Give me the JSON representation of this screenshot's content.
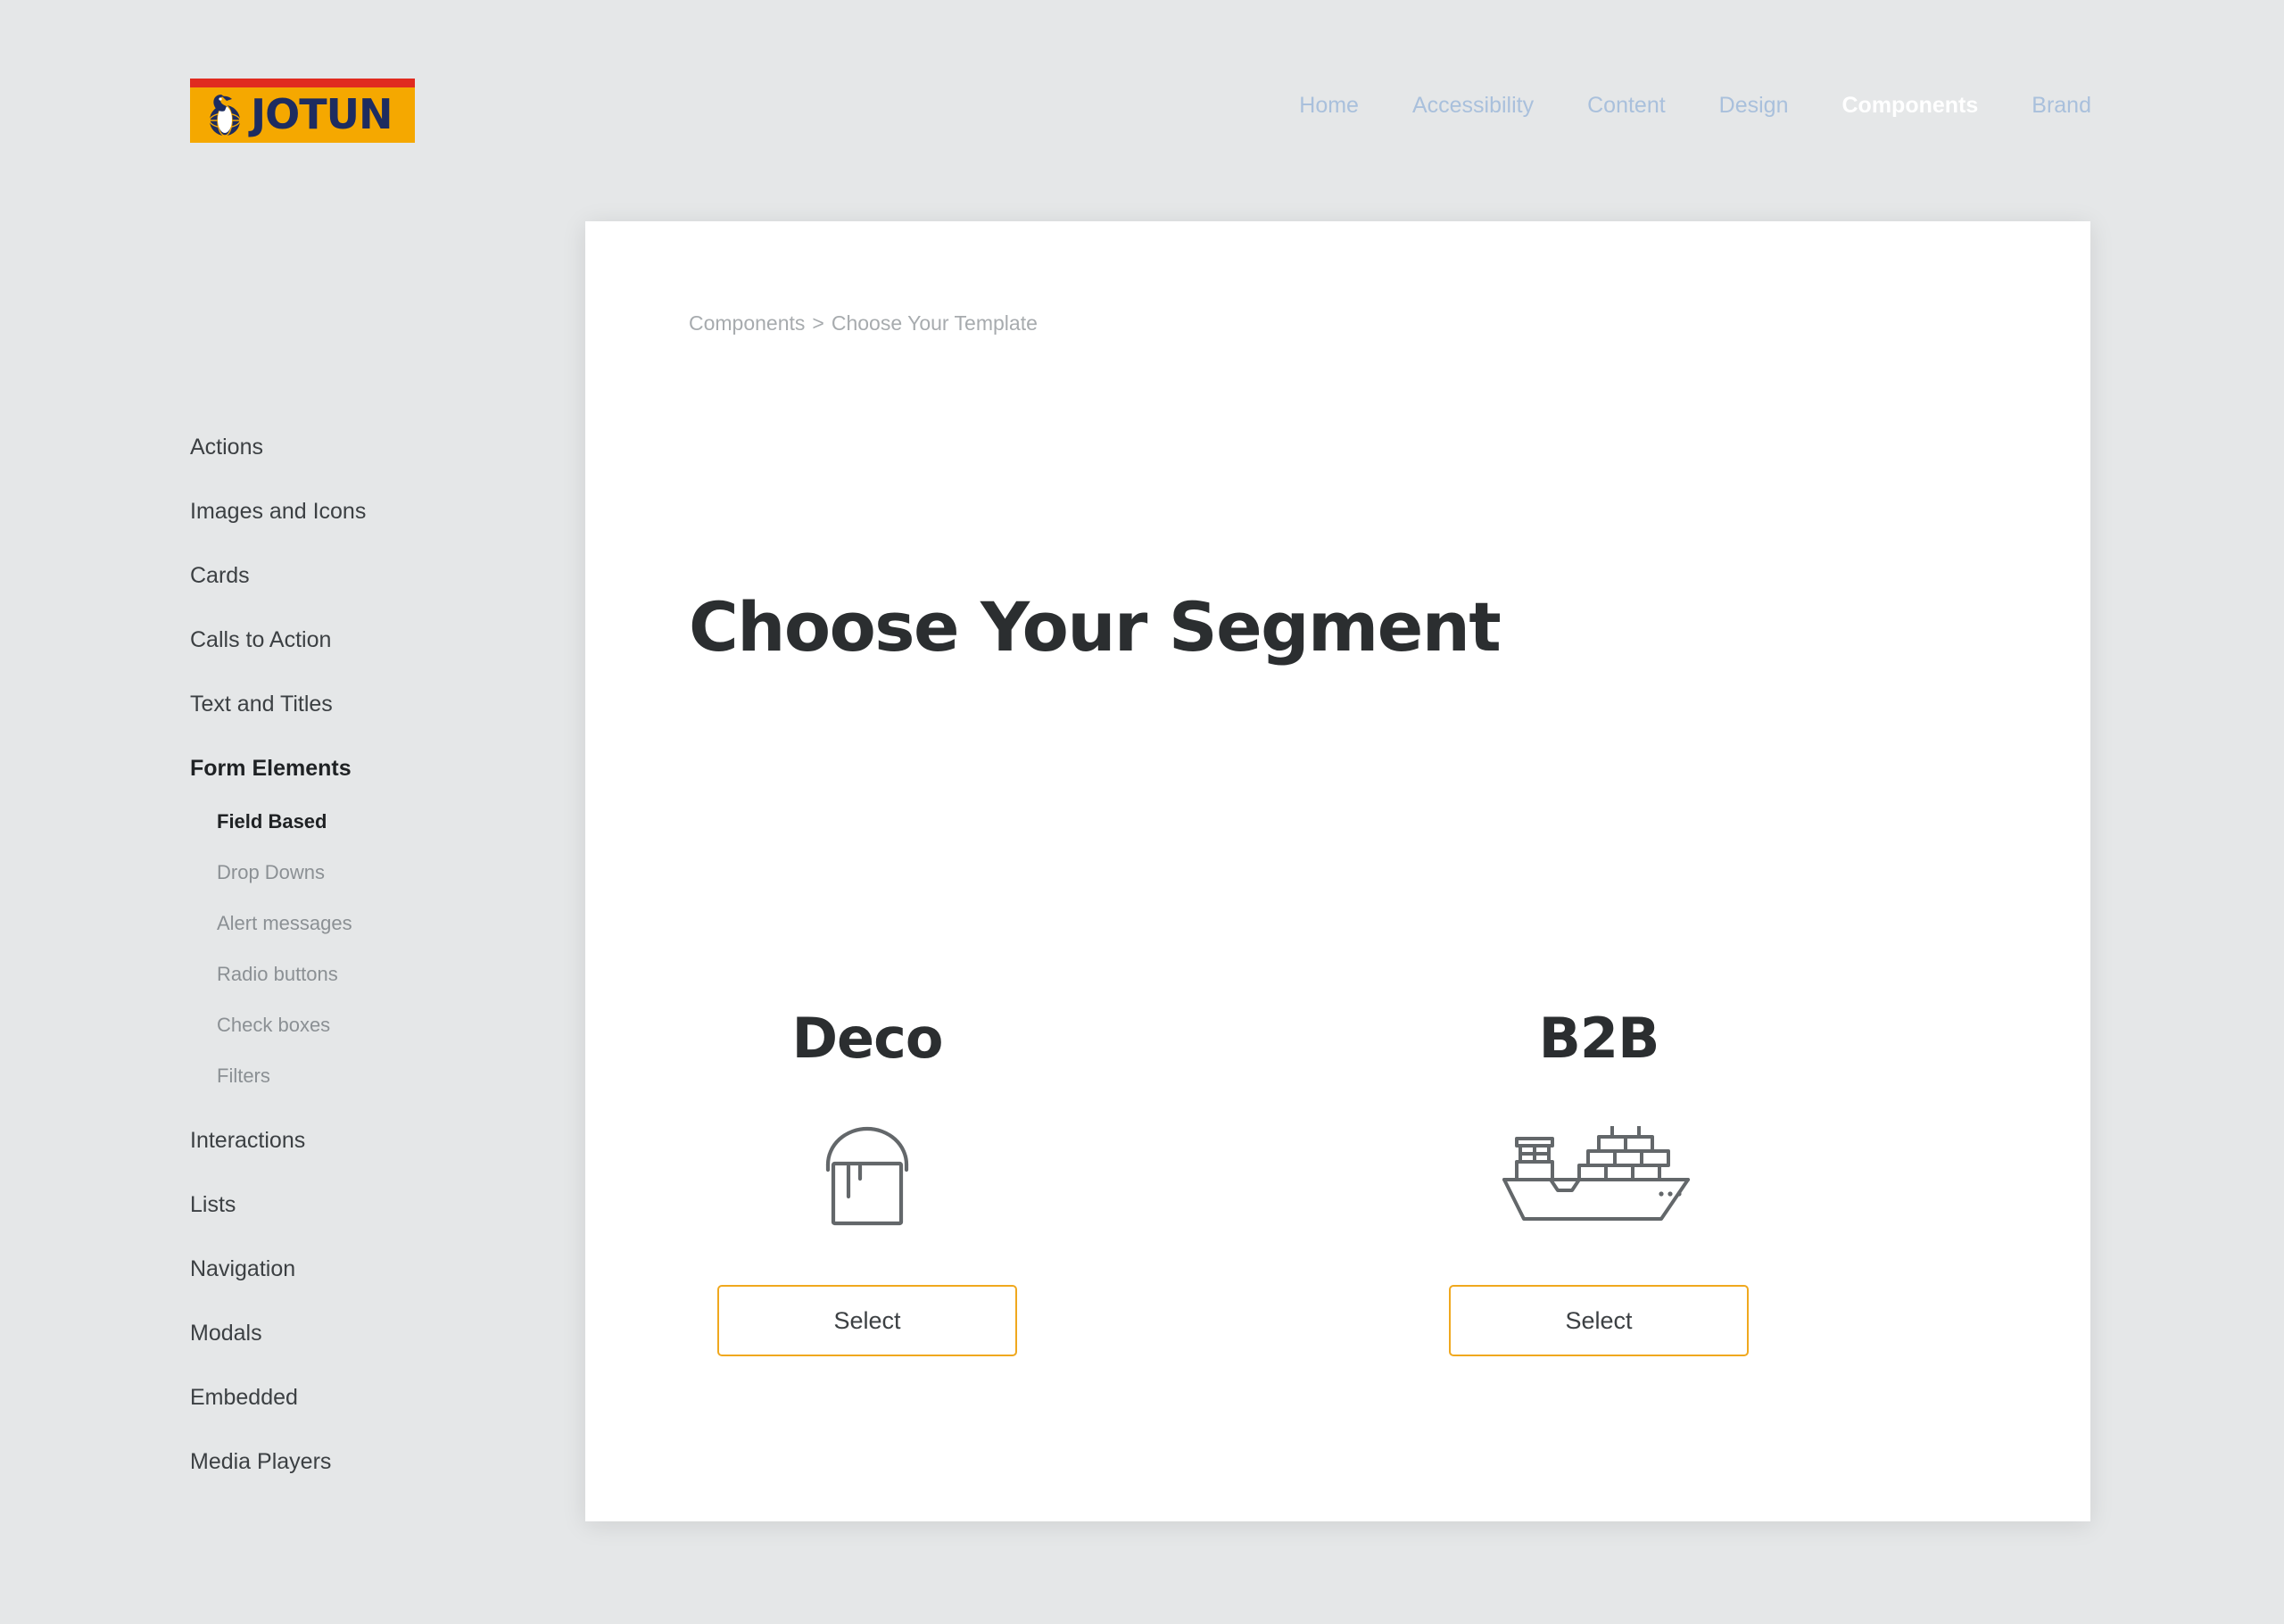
{
  "header": {
    "logo": {
      "wordmark": "JOTUN",
      "emblem_name": "jotun-bird-globe-emblem",
      "stripe_color": "#e02b20",
      "background_color": "#f5a800",
      "text_color": "#1d2c60"
    },
    "gradient_top": "#0b3c74",
    "gradient_bottom": "#041d38",
    "nav": [
      {
        "label": "Home",
        "active": false
      },
      {
        "label": "Accessibility",
        "active": false
      },
      {
        "label": "Content",
        "active": false
      },
      {
        "label": "Design",
        "active": false
      },
      {
        "label": "Components",
        "active": true
      },
      {
        "label": "Brand",
        "active": false
      }
    ]
  },
  "sidebar": {
    "items": [
      {
        "label": "Actions",
        "current": false
      },
      {
        "label": "Images and Icons",
        "current": false
      },
      {
        "label": "Cards",
        "current": false
      },
      {
        "label": "Calls to Action",
        "current": false
      },
      {
        "label": "Text and Titles",
        "current": false
      },
      {
        "label": "Form Elements",
        "current": true
      }
    ],
    "subitems": [
      {
        "label": "Field Based",
        "current": true
      },
      {
        "label": "Drop Downs",
        "current": false
      },
      {
        "label": "Alert messages",
        "current": false
      },
      {
        "label": "Radio buttons",
        "current": false
      },
      {
        "label": "Check boxes",
        "current": false
      },
      {
        "label": "Filters",
        "current": false
      }
    ],
    "items_after": [
      {
        "label": "Interactions",
        "current": false
      },
      {
        "label": "Lists",
        "current": false
      },
      {
        "label": "Navigation",
        "current": false
      },
      {
        "label": "Modals",
        "current": false
      },
      {
        "label": "Embedded",
        "current": false
      },
      {
        "label": "Media Players",
        "current": false
      }
    ]
  },
  "main": {
    "breadcrumb": {
      "parent": "Components",
      "separator": ">",
      "current": "Choose Your Template"
    },
    "title": "Choose Your Segment",
    "segments": [
      {
        "title": "Deco",
        "icon_name": "paint-bucket-icon",
        "button_label": "Select"
      },
      {
        "title": "B2B",
        "icon_name": "cargo-ship-icon",
        "button_label": "Select"
      }
    ],
    "accent_color": "#f0a81e"
  }
}
